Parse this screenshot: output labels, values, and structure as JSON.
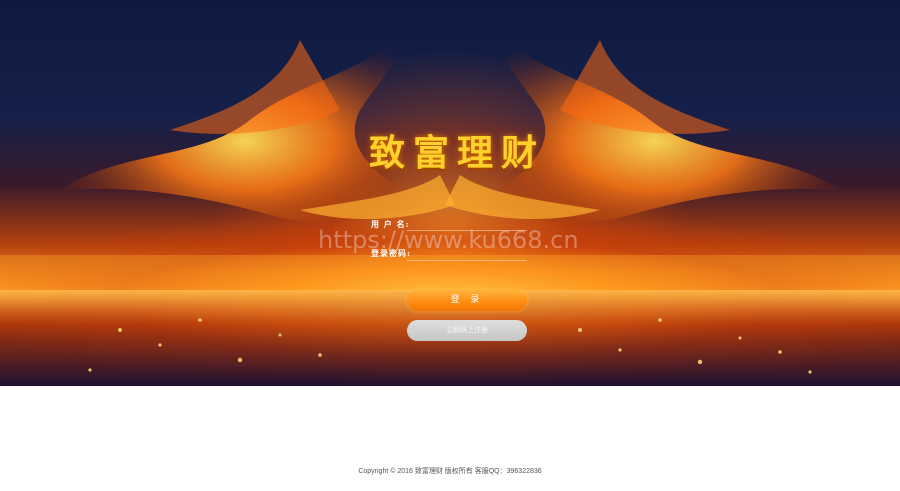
{
  "app": {
    "title": "致富理财"
  },
  "form": {
    "username_label": "用 户 名:",
    "username_value": "",
    "password_label": "登录密码:",
    "password_value": "",
    "login_label": "登 录",
    "register_label": "立即网上注册"
  },
  "watermark": {
    "text": "https://www.ku668.cn"
  },
  "footer": {
    "copyright": "Copyright © 2016 致富理财 版权所有 客服QQ：396322836"
  },
  "colors": {
    "title": "#ffd12a",
    "login_button": "#ff8a12",
    "register_button": "#cccccc",
    "sky": "#101a3f",
    "fire": "#ff8a18"
  }
}
